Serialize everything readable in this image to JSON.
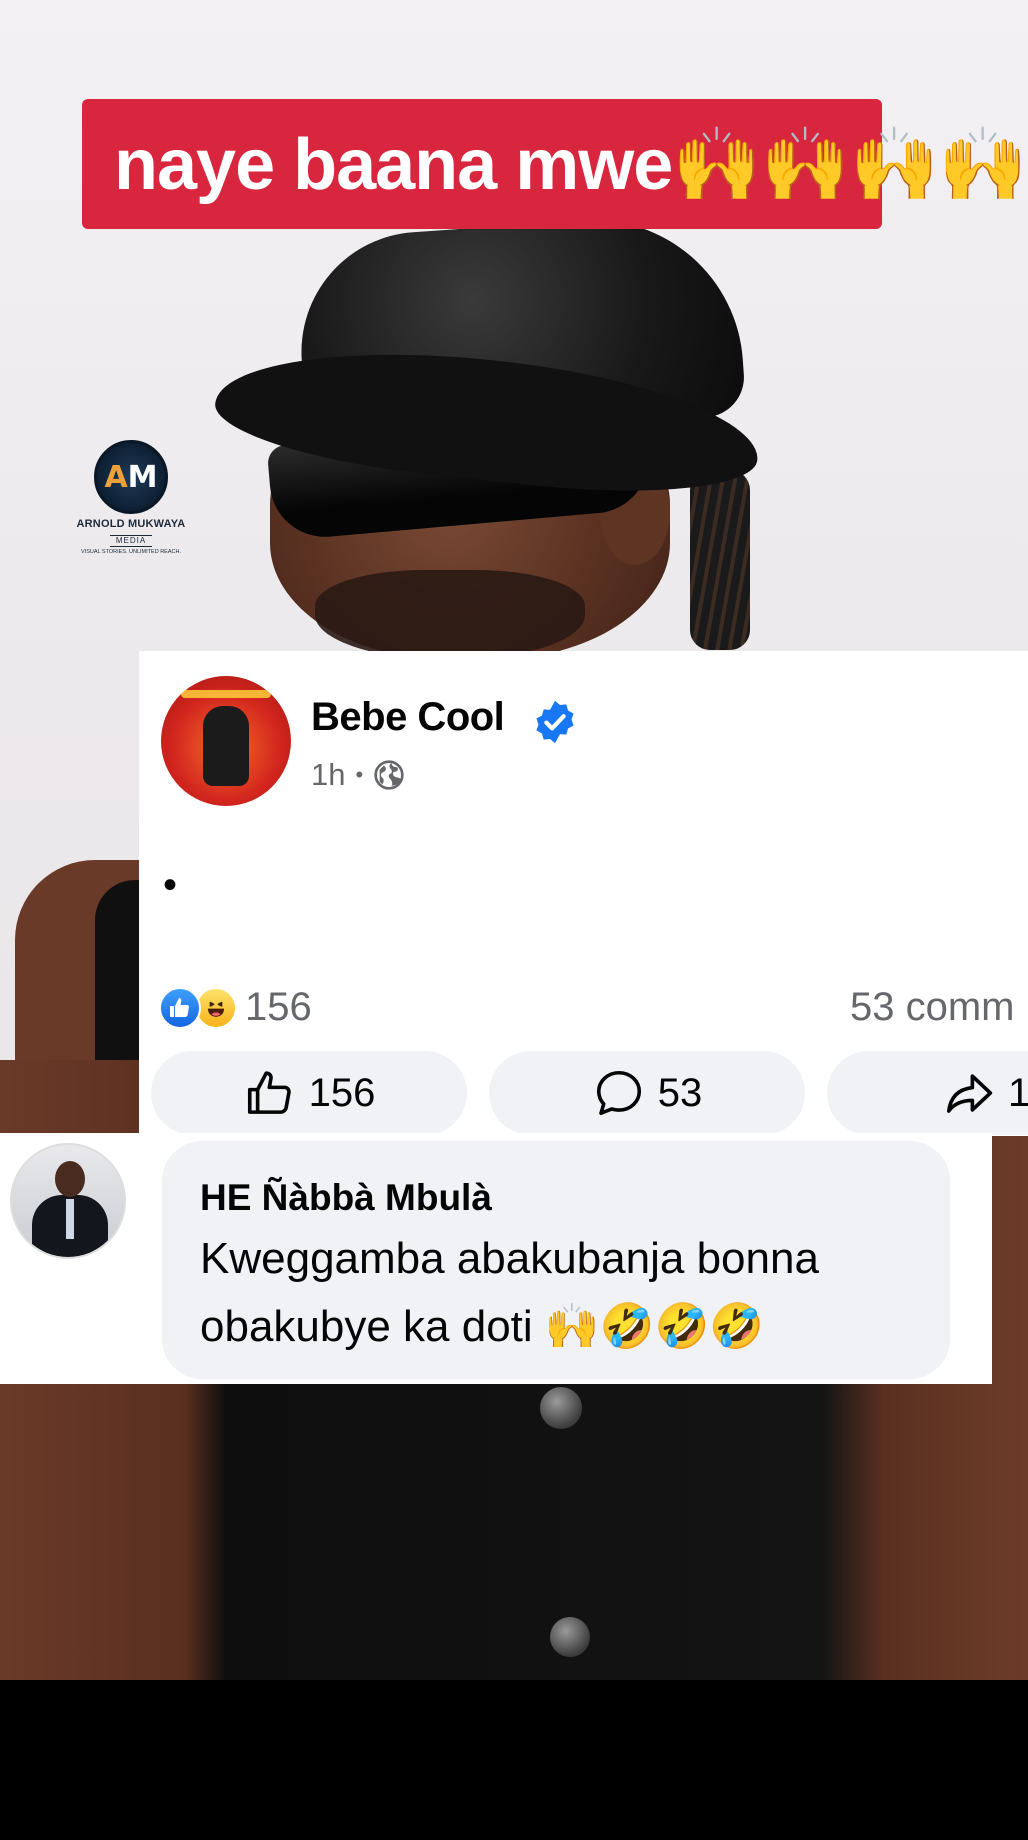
{
  "caption": {
    "text": "naye baana mwe🙌🙌🙌🙌",
    "bg_color": "#d9263f"
  },
  "watermark": {
    "name": "ARNOLD MUKWAYA",
    "sub": "MEDIA",
    "tagline": "VISUAL STORIES. UNLIMITED REACH."
  },
  "post": {
    "author": "Bebe Cool",
    "time": "1h",
    "separator": "•",
    "body": "•",
    "reaction_count": "156",
    "comments_count": "53 comm",
    "actions": {
      "like_count": "156",
      "comment_count": "53",
      "share_count": "1"
    }
  },
  "comment": {
    "author": "HE Ñàbbà Mbulà",
    "text": "Kweggamba abakubanja bonna obakubye ka doti 🙌🤣🤣🤣"
  },
  "colors": {
    "facebook_blue": "#1877f2",
    "muted_text": "#65676b",
    "button_bg": "#f0f2f5"
  }
}
